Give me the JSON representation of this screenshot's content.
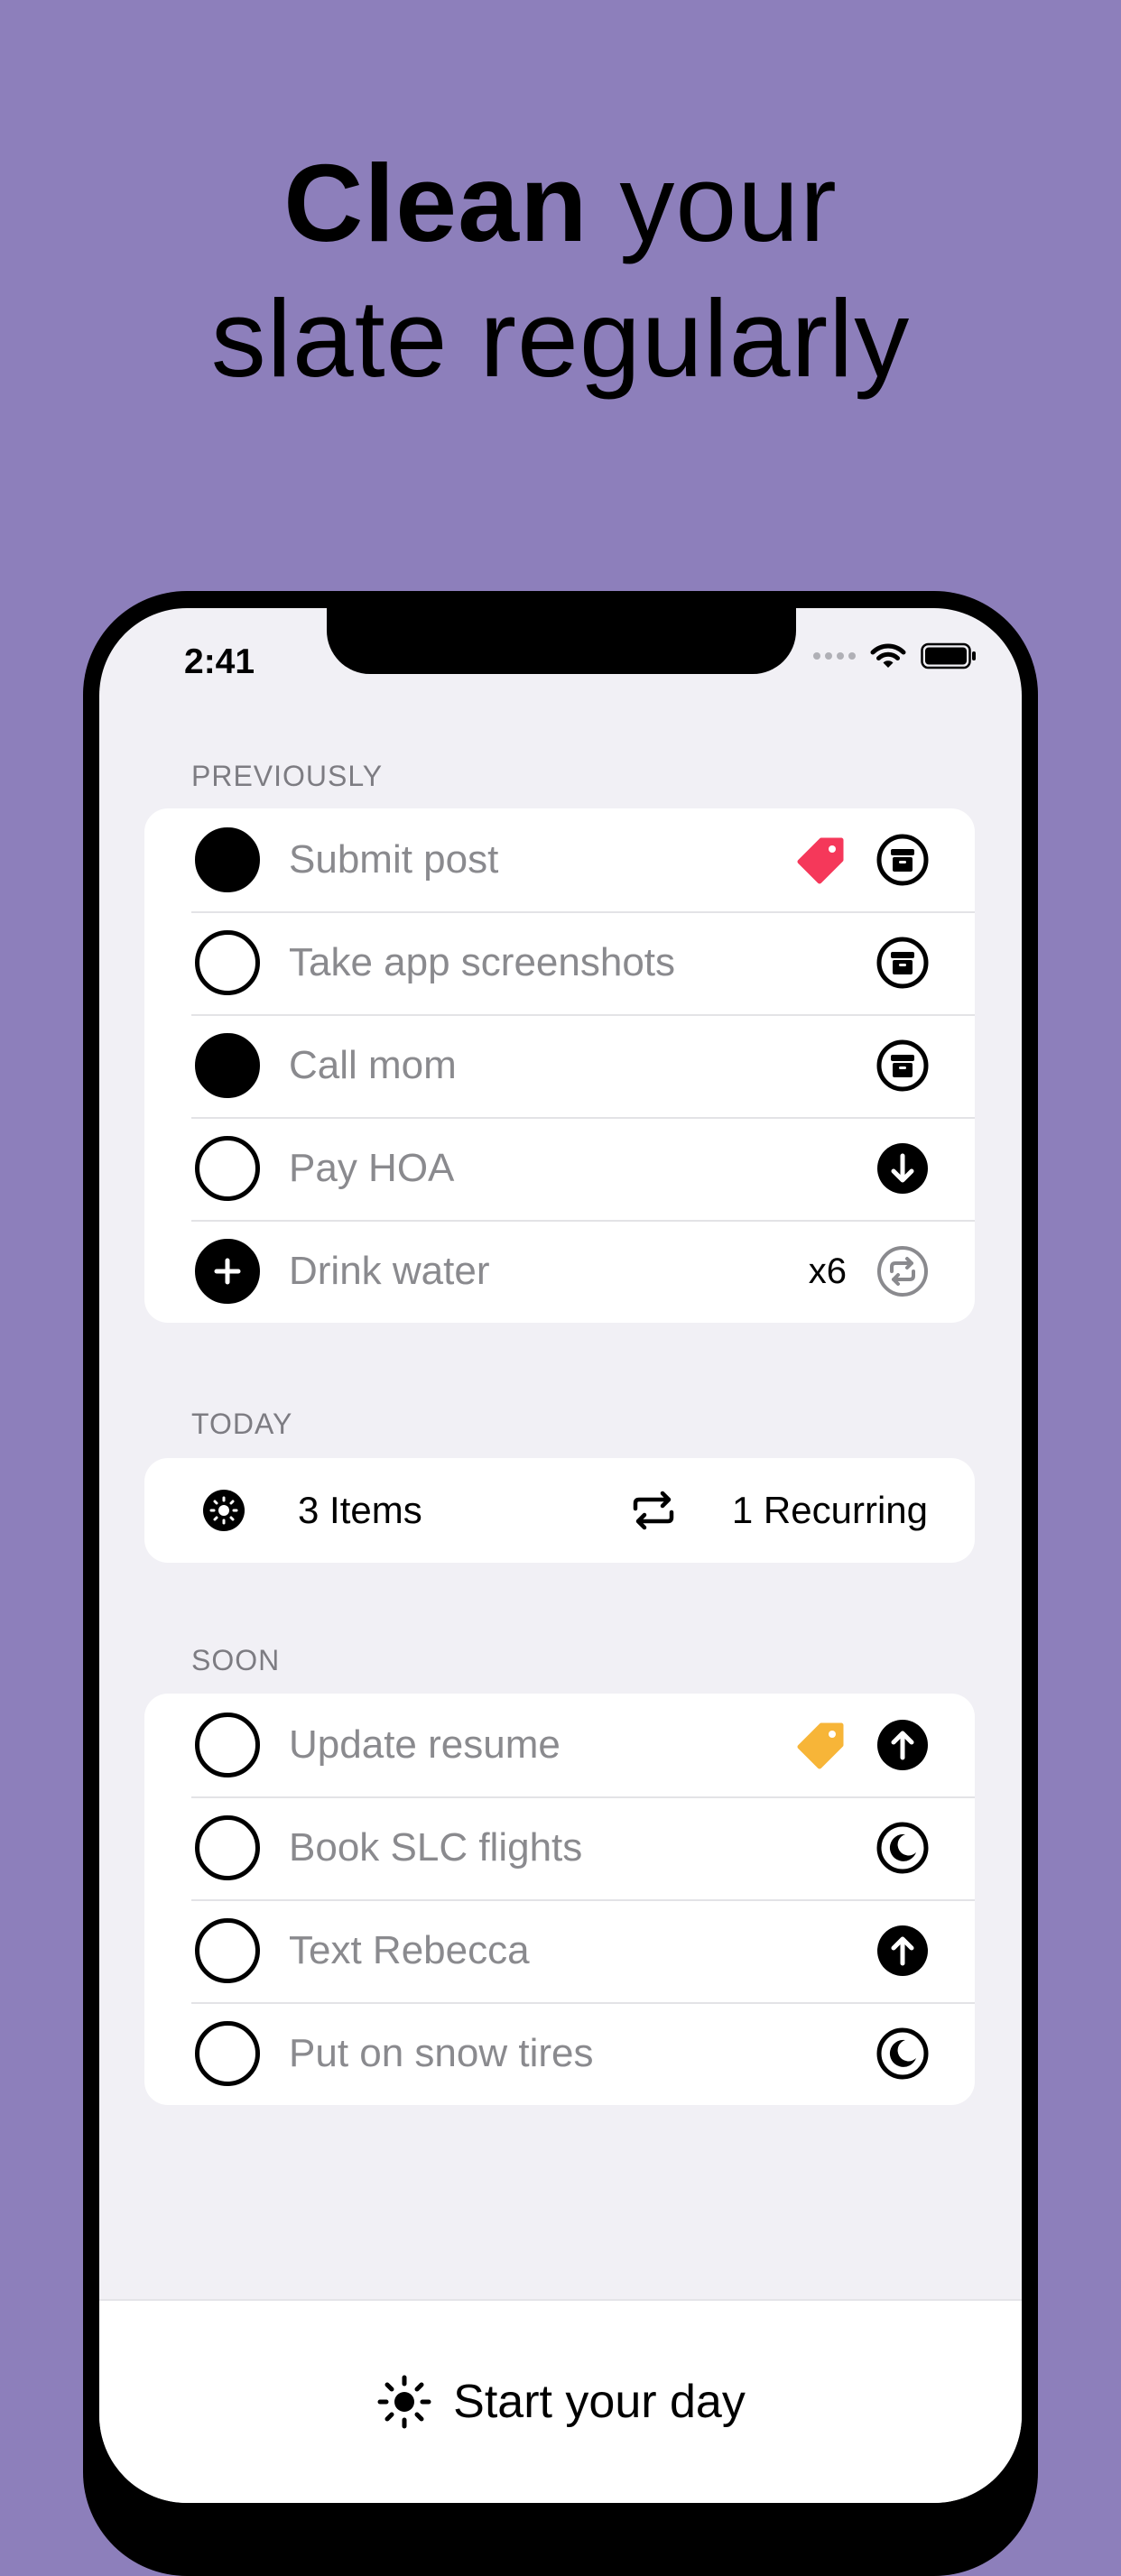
{
  "headline": {
    "bold": "Clean",
    "rest_line1": " your",
    "line2": "slate regularly"
  },
  "status_bar": {
    "time": "2:41"
  },
  "sections": {
    "previously": {
      "label": "PREVIOUSLY",
      "items": [
        {
          "title": "Submit post",
          "check": "filled",
          "tag": "red-tag-icon",
          "action": "archive-icon"
        },
        {
          "title": "Take app screenshots",
          "check": "empty",
          "action": "archive-icon"
        },
        {
          "title": "Call mom",
          "check": "filled",
          "action": "archive-icon"
        },
        {
          "title": "Pay HOA",
          "check": "empty",
          "action": "arrow-down-icon"
        },
        {
          "title": "Drink water",
          "check": "plus",
          "count": "x6",
          "action": "repeat-icon"
        }
      ]
    },
    "today": {
      "label": "TODAY",
      "items_text": "3 Items",
      "recurring_text": "1 Recurring"
    },
    "soon": {
      "label": "SOON",
      "items": [
        {
          "title": "Update resume",
          "check": "empty",
          "tag": "yellow-tag-icon",
          "action": "arrow-up-icon"
        },
        {
          "title": "Book SLC flights",
          "check": "empty",
          "action": "moon-icon"
        },
        {
          "title": "Text Rebecca",
          "check": "empty",
          "action": "arrow-up-icon"
        },
        {
          "title": "Put on snow tires",
          "check": "empty",
          "action": "moon-icon"
        }
      ]
    }
  },
  "bottom": {
    "start_label": "Start your day"
  },
  "colors": {
    "background": "#8d7fbb",
    "tag_red": "#f5385a",
    "tag_yellow": "#f7b538"
  }
}
